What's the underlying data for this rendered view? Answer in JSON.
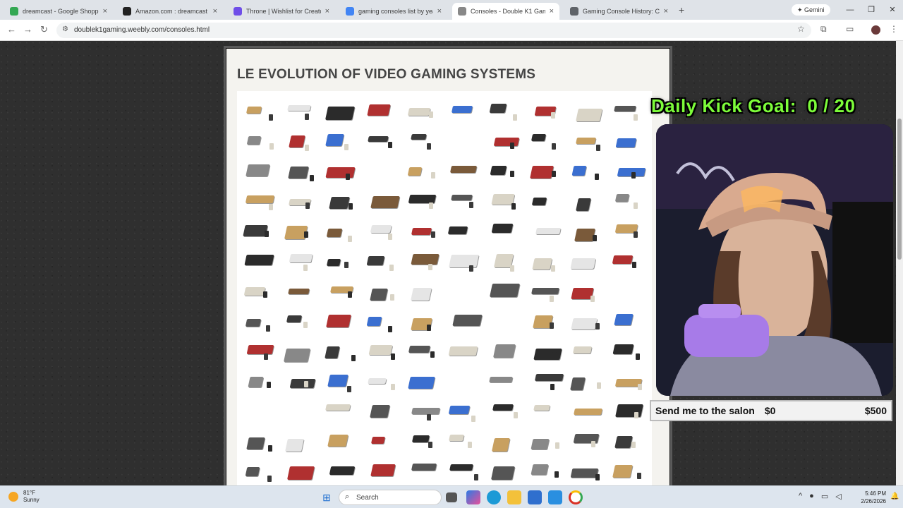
{
  "browser": {
    "tabs": [
      {
        "title": "dreamcast - Google Shopping",
        "icon": "google-shopping-icon",
        "color": "#34a853",
        "active": false
      },
      {
        "title": "Amazon.com : dreamcast cons",
        "icon": "amazon-icon",
        "color": "#222222",
        "active": false
      },
      {
        "title": "Throne | Wishlist for Creators -",
        "icon": "throne-icon",
        "color": "#6f4ee8",
        "active": false
      },
      {
        "title": "gaming consoles list by year - G",
        "icon": "google-icon",
        "color": "#4285f4",
        "active": false
      },
      {
        "title": "Consoles - Double K1 Gaming",
        "icon": "weebly-icon",
        "color": "#888888",
        "active": true
      },
      {
        "title": "Gaming Console History: Comp",
        "icon": "link-icon",
        "color": "#5f6368",
        "active": false
      }
    ],
    "new_tab": "+",
    "gemini_label": "Gemini",
    "url": "doublek1gaming.weebly.com/consoles.html",
    "window_controls": [
      "—",
      "❐",
      "✕"
    ]
  },
  "page": {
    "heading": "LE EVOLUTION OF VIDEO GAMING SYSTEMS"
  },
  "overlay": {
    "goal_label": "Daily Kick Goal:",
    "goal_value": "0 / 20",
    "goal_color": "#7dfc3a",
    "salon_label": "Send me to the salon",
    "salon_current": "$0",
    "salon_target": "$500"
  },
  "taskbar": {
    "temperature": "81°F",
    "condition": "Sunny",
    "search_placeholder": "Search",
    "time": "5:46 PM",
    "date": "2/26/2026"
  }
}
